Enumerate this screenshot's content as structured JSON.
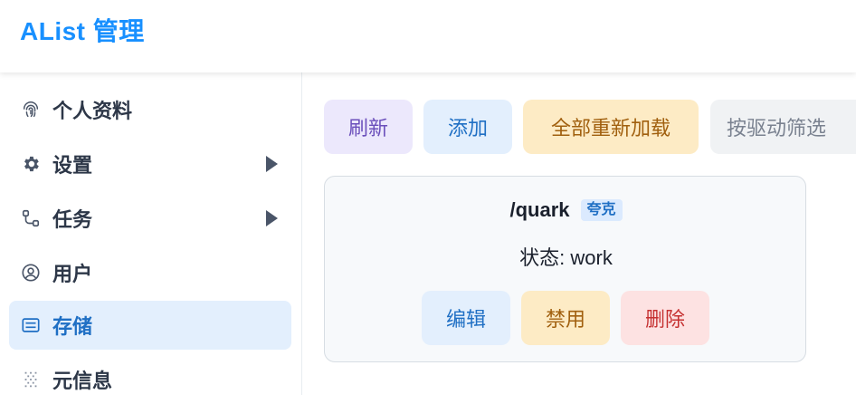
{
  "header": {
    "title": "AList 管理",
    "accent_color": "#1890ff"
  },
  "sidebar": {
    "items": [
      {
        "label": "个人资料",
        "icon": "fingerprint-icon",
        "has_submenu": false,
        "active": false
      },
      {
        "label": "设置",
        "icon": "gear-icon",
        "has_submenu": true,
        "active": false
      },
      {
        "label": "任务",
        "icon": "workflow-icon",
        "has_submenu": true,
        "active": false
      },
      {
        "label": "用户",
        "icon": "user-circle-icon",
        "has_submenu": false,
        "active": false
      },
      {
        "label": "存储",
        "icon": "storage-icon",
        "has_submenu": false,
        "active": true
      },
      {
        "label": "元信息",
        "icon": "meta-icon",
        "has_submenu": false,
        "active": false
      }
    ]
  },
  "toolbar": {
    "refresh_label": "刷新",
    "add_label": "添加",
    "reload_all_label": "全部重新加载",
    "filter_placeholder": "按驱动筛选"
  },
  "storage_card": {
    "mount_path": "/quark",
    "driver": "夸克",
    "status": "状态: work",
    "edit_label": "编辑",
    "disable_label": "禁用",
    "delete_label": "删除"
  },
  "colors": {
    "active_bg": "#e3effd",
    "active_text": "#1f6fc4",
    "purple_bg": "#ece8fc",
    "orange_bg": "#fdebc5",
    "red_bg": "#fde2e2"
  }
}
